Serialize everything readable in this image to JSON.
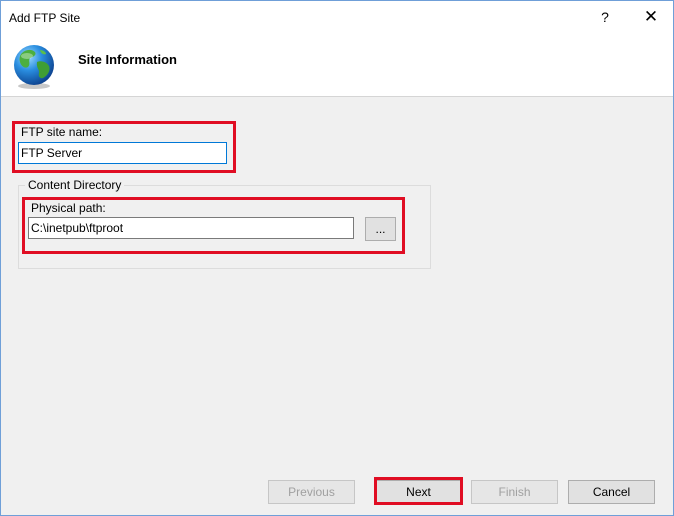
{
  "window": {
    "title": "Add FTP Site",
    "help_glyph": "?",
    "close_glyph": "✕"
  },
  "header": {
    "title": "Site Information",
    "icon": "globe-icon"
  },
  "form": {
    "site_name_label": "FTP site name:",
    "site_name_value": "FTP Server",
    "content_directory_label": "Content Directory",
    "physical_path_label": "Physical path:",
    "physical_path_value": "C:\\inetpub\\ftproot",
    "browse_label": "..."
  },
  "buttons": {
    "previous": "Previous",
    "next": "Next",
    "finish": "Finish",
    "cancel": "Cancel"
  },
  "colors": {
    "highlight": "#e00d23",
    "focus_border": "#0078d7",
    "dialog_background": "#f0f0f0"
  }
}
